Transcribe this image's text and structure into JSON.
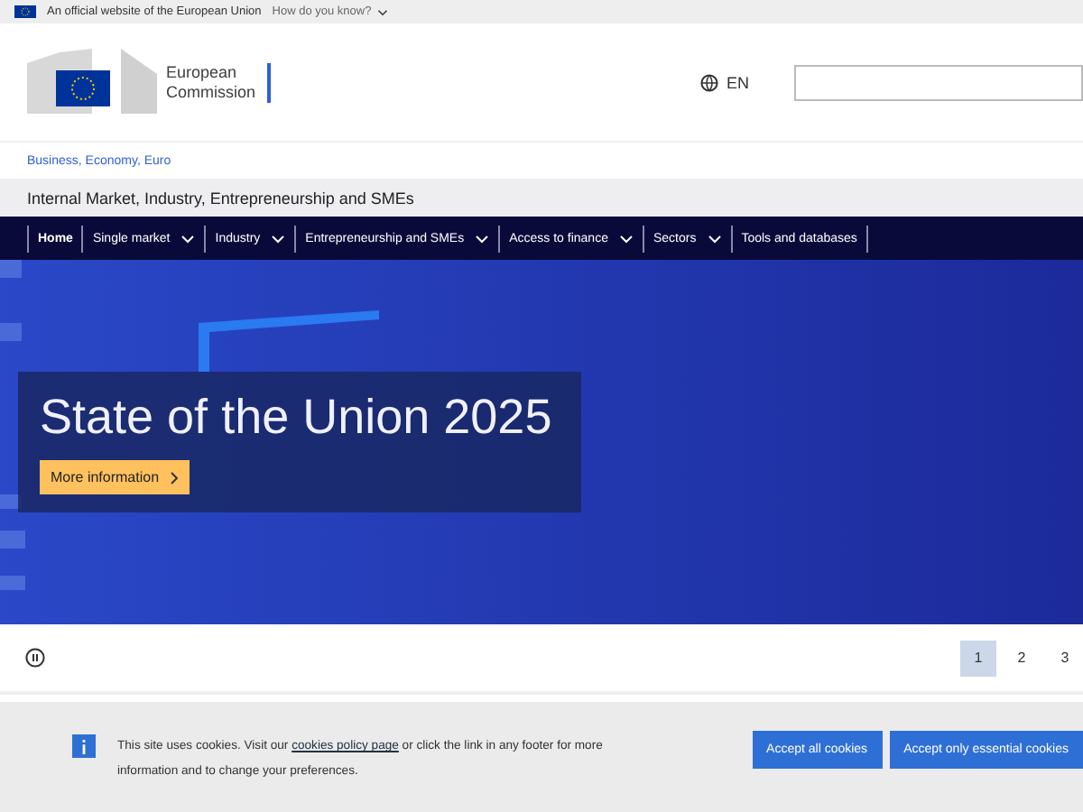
{
  "eu_bar": {
    "text": "An official website of the European Union",
    "link": "How do you know?"
  },
  "header": {
    "logo_line1": "European",
    "logo_line2": "Commission",
    "language": "EN"
  },
  "breadcrumb": "Business, Economy, Euro",
  "site_name": "Internal Market, Industry, Entrepreneurship and SMEs",
  "nav": [
    {
      "label": "Home",
      "selected": true,
      "has_menu": false
    },
    {
      "label": "Single market",
      "selected": false,
      "has_menu": true
    },
    {
      "label": "Industry",
      "selected": false,
      "has_menu": true
    },
    {
      "label": "Entrepreneurship and SMEs",
      "selected": false,
      "has_menu": true
    },
    {
      "label": "Access to finance",
      "selected": false,
      "has_menu": true
    },
    {
      "label": "Sectors",
      "selected": false,
      "has_menu": true
    },
    {
      "label": "Tools and databases",
      "selected": false,
      "has_menu": false
    }
  ],
  "hero": {
    "kind": "picture",
    "title": "State of the Union 2025",
    "button": "More information"
  },
  "pager": [
    {
      "label": "1",
      "selected": true
    },
    {
      "label": "2",
      "selected": false
    },
    {
      "label": "3",
      "selected": false
    }
  ],
  "cookie_banner": {
    "text_before": "This site uses cookies. Visit our ",
    "link": "cookies policy page",
    "text_after": " or click the link in any footer for more information and to change your preferences.",
    "buttons": [
      "Accept all cookies",
      "Accept only essential cookies"
    ]
  }
}
